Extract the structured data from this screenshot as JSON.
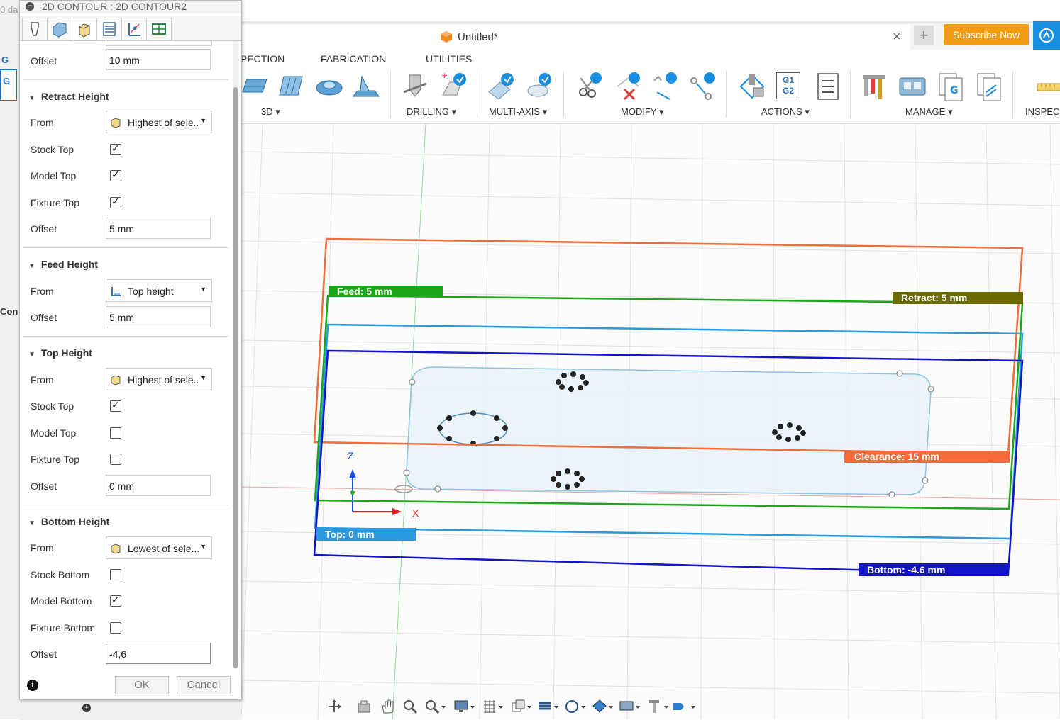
{
  "window": {
    "doc_title": "Untitled*",
    "subscribe_label": "Subscribe Now",
    "left_clip_text": "0 da",
    "left_clip_g": "G",
    "left_clip_con": "Con"
  },
  "workspace_tabs": [
    "PECTION",
    "FABRICATION",
    "UTILITIES"
  ],
  "toolbar_groups": {
    "g3d": "3D",
    "drilling": "DRILLING",
    "multi_axis": "MULTI-AXIS",
    "modify": "MODIFY",
    "actions": "ACTIONS",
    "manage": "MANAGE",
    "inspect": "INSPEC",
    "g1g2_top": "G1",
    "g1g2_bottom": "G2"
  },
  "dialog": {
    "title": "2D CONTOUR : 2D CONTOUR2",
    "tabs": [
      "tool-tab",
      "geometry-tab",
      "heights-tab",
      "passes-tab",
      "linking-tab",
      "post-tab"
    ],
    "active_tab": 2,
    "top_offset": {
      "label": "Offset",
      "value": "10 mm"
    },
    "retract": {
      "title": "Retract Height",
      "from_label": "From",
      "from_value": "Highest of sele...",
      "stock_top_label": "Stock Top",
      "stock_top": true,
      "model_top_label": "Model Top",
      "model_top": true,
      "fixture_top_label": "Fixture Top",
      "fixture_top": true,
      "offset_label": "Offset",
      "offset_value": "5 mm"
    },
    "feed": {
      "title": "Feed Height",
      "from_label": "From",
      "from_value": "Top height",
      "offset_label": "Offset",
      "offset_value": "5 mm"
    },
    "top": {
      "title": "Top Height",
      "from_label": "From",
      "from_value": "Highest of sele...",
      "stock_top_label": "Stock Top",
      "stock_top": true,
      "model_top_label": "Model Top",
      "model_top": false,
      "fixture_top_label": "Fixture Top",
      "fixture_top": false,
      "offset_label": "Offset",
      "offset_value": "0 mm"
    },
    "bottom": {
      "title": "Bottom Height",
      "from_label": "From",
      "from_value": "Lowest of sele...",
      "stock_bottom_label": "Stock Bottom",
      "stock_bottom": false,
      "model_bottom_label": "Model Bottom",
      "model_bottom": true,
      "fixture_bottom_label": "Fixture Bottom",
      "fixture_bottom": false,
      "offset_label": "Offset",
      "offset_value": "-4,6"
    },
    "ok_label": "OK",
    "cancel_label": "Cancel"
  },
  "viewport": {
    "feed_label": "Feed: 5 mm",
    "retract_label": "Retract: 5 mm",
    "clearance_label": "Clearance: 15 mm",
    "top_label": "Top: 0 mm",
    "bottom_label": "Bottom: -4.6 mm",
    "axis_z": "Z",
    "axis_x": "X",
    "colors": {
      "clearance": "#f26b3a",
      "feed": "#1aa81a",
      "retract": "#6b6b00",
      "top": "#2a9ae0",
      "bottom": "#1414c8"
    }
  },
  "bottom_toolbar": [
    "pan-icon",
    "look-at-icon",
    "hand-icon",
    "zoom-icon",
    "zoom-window-icon",
    "display-icon",
    "grid-icon",
    "views-icon",
    "section-icon",
    "orbit-icon",
    "visual-style-icon",
    "camera-icon",
    "tool-icon",
    "environment-icon"
  ]
}
